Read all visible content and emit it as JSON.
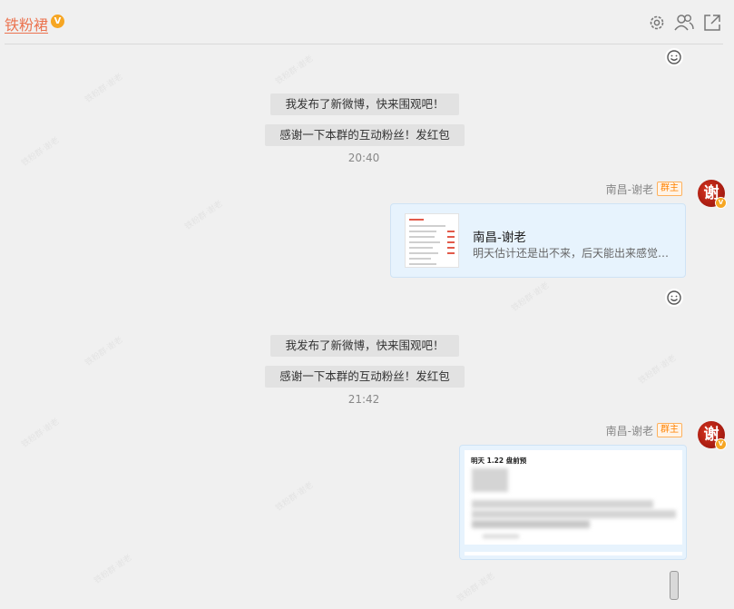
{
  "header": {
    "group_name": "铁粉裙",
    "badge_icon": "vip-badge-icon",
    "icons": [
      "settings-gear-icon",
      "members-icon",
      "open-external-icon"
    ]
  },
  "messages": [
    {
      "type": "system",
      "lines": [
        "我发布了新微博，快来围观吧！",
        "感谢一下本群的互动粉丝！发红包"
      ],
      "time": "20:40"
    },
    {
      "type": "share_card",
      "sender": "南昌-谢老",
      "role": "群主",
      "avatar_char": "谢",
      "card": {
        "title": "南昌-谢老",
        "desc": "明天估计还是出不来，后天能出来感觉…"
      }
    },
    {
      "type": "system",
      "lines": [
        "我发布了新微博，快来围观吧！",
        "感谢一下本群的互动粉丝！发红包"
      ],
      "time": "21:42"
    },
    {
      "type": "image",
      "sender": "南昌-谢老",
      "role": "群主",
      "avatar_char": "谢",
      "image_heading": "明天 1.22 盘前预"
    }
  ],
  "colors": {
    "accent": "#eb7350",
    "role_orange": "#ff8200",
    "card_bg": "#e7f3fd"
  }
}
